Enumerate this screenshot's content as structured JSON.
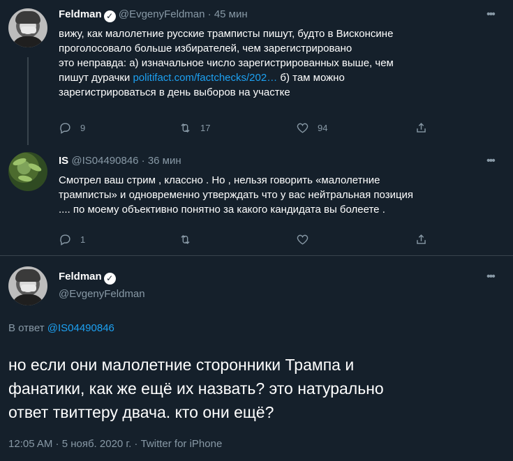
{
  "tweet1": {
    "name": "Feldman",
    "handle": "@EvgenyFeldman",
    "time": "· 45 мин",
    "line1": "вижу, как малолетние русские трамписты пишут, будто в Висконсине",
    "line2": "проголосовало больше избирателей, чем зарегистрировано",
    "line3": "это неправда: а) изначальное число зарегистрированных выше, чем",
    "line4_pre": "пишут дурачки ",
    "line4_link": "politifact.com/factchecks/202…",
    "line4_post": " б) там можно",
    "line5": "зарегистрироваться в день выборов на участке",
    "replies": "9",
    "retweets": "17",
    "likes": "94"
  },
  "tweet2": {
    "name": "IS",
    "handle": "@IS04490846",
    "time": "· 36 мин",
    "line1": "Смотрел ваш стрим , классно . Но , нельзя говорить «малолетние",
    "line2": "трамписты» и одновременно утверждать что у вас нейтральная позиция",
    "line3": ".... по моему объективно понятно за какого кандидата вы болеете .",
    "replies": "1"
  },
  "main": {
    "name": "Feldman",
    "handle": "@EvgenyFeldman",
    "reply_prefix": "В ответ ",
    "reply_handle": "@IS04490846",
    "line1": "но если они малолетние сторонники Трампа и",
    "line2": "фанатики, как же ещё их назвать? это натурально",
    "line3": "ответ твиттеру двача. кто они ещё?",
    "meta": "12:05 AM · 5 нояб. 2020 г. · Twitter for iPhone"
  },
  "icons": {
    "more": "more-icon",
    "verified": "verified-badge-icon",
    "reply": "reply-icon",
    "retweet": "retweet-icon",
    "like": "heart-icon",
    "share": "share-icon"
  },
  "colors": {
    "background": "#15202b",
    "secondary_text": "#8899a6",
    "link": "#1da1f2",
    "divider": "#38444d"
  }
}
